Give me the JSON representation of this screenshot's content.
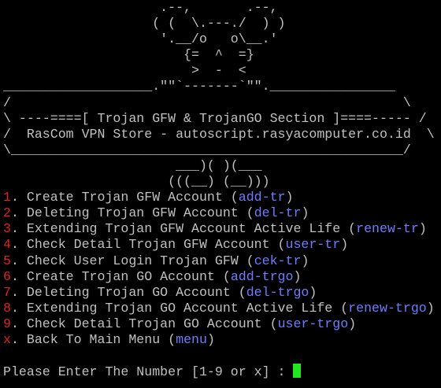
{
  "colors": {
    "background": "#000000",
    "text": "#c0c0c0",
    "menu_number": "#e02020",
    "command": "#6f7cff",
    "cursor": "#22e622"
  },
  "banner_lines": [
    "                    .--,       .--,",
    "                   ( (  \\.---./  ) )",
    "                    '.__/o   o\\__.'",
    "                       {=  ^  =}",
    "                        >  -  <",
    "___________________.\"\"`-------`\"\".________________",
    "/                                                  \\",
    "\\ ----====[ Trojan GFW & TrojanGO Section ]====----- /",
    "/  RasCom VPN Store - autoscript.rasyacomputer.co.id  \\",
    "\\__________________________________________________/",
    "                      ___)( )(___",
    "                     (((__) (__)))"
  ],
  "menu": [
    {
      "number": "1",
      "label": "Create Trojan GFW Account",
      "command": "add-tr"
    },
    {
      "number": "2",
      "label": "Deleting Trojan GFW Account",
      "command": "del-tr"
    },
    {
      "number": "3",
      "label": "Extending Trojan GFW Account Active Life",
      "command": "renew-tr"
    },
    {
      "number": "4",
      "label": "Check Detail Trojan GFW Account",
      "command": "user-tr"
    },
    {
      "number": "5",
      "label": "Check User Login Trojan GFW",
      "command": "cek-tr"
    },
    {
      "number": "6",
      "label": "Create Trojan GO Account",
      "command": "add-trgo"
    },
    {
      "number": "7",
      "label": "Deleting Trojan GO Account",
      "command": "del-trgo"
    },
    {
      "number": "8",
      "label": "Extending Trojan GO Account Active Life",
      "command": "renew-trgo"
    },
    {
      "number": "9",
      "label": "Check Detail Trojan GO Account",
      "command": "user-trgo"
    },
    {
      "number": "x",
      "label": "Back To Main Menu",
      "command": "menu"
    }
  ],
  "prompt": "Please Enter The Number [1-9 or x] : "
}
